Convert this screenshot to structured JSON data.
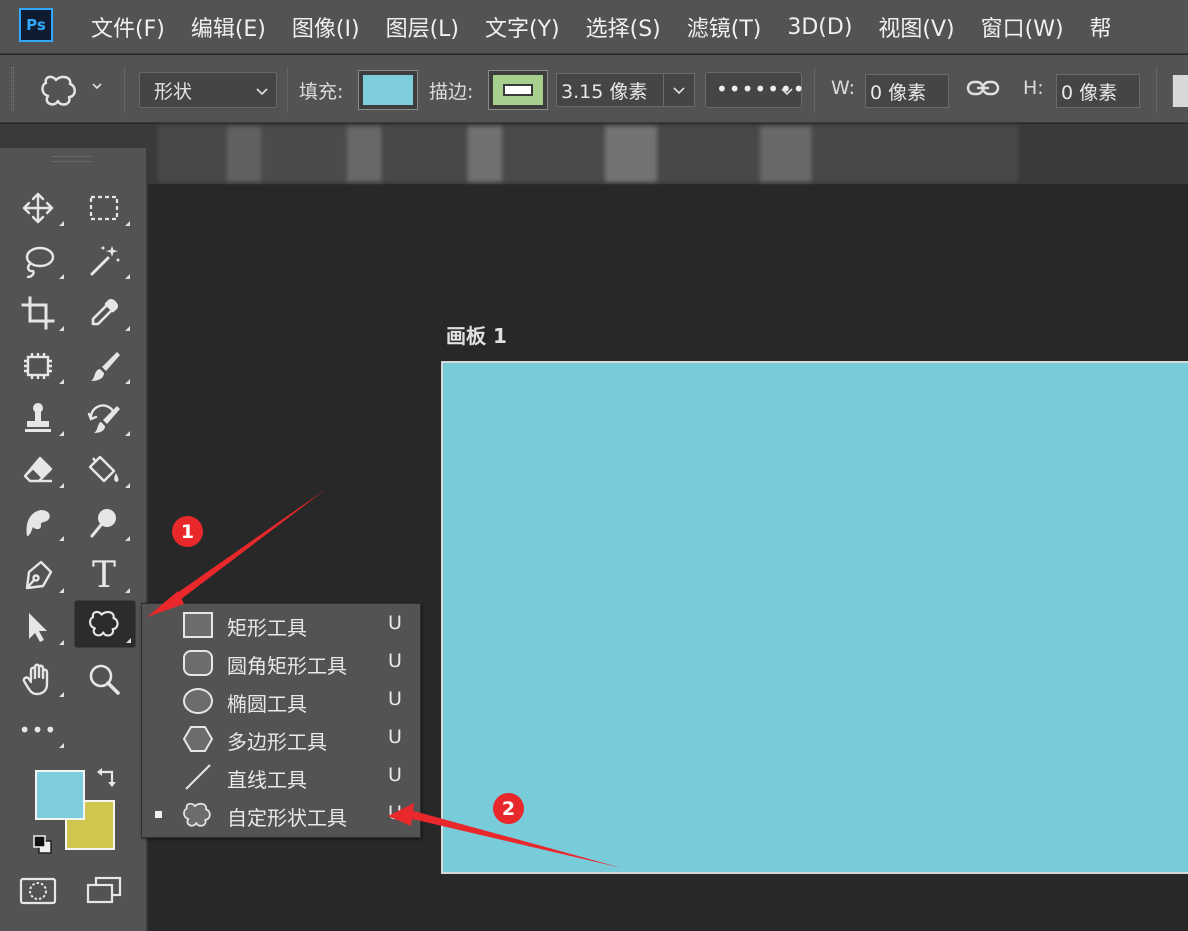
{
  "app": {
    "logo_text": "Ps"
  },
  "menu": [
    "文件(F)",
    "编辑(E)",
    "图像(I)",
    "图层(L)",
    "文字(Y)",
    "选择(S)",
    "滤镜(T)",
    "3D(D)",
    "视图(V)",
    "窗口(W)",
    "帮"
  ],
  "options": {
    "mode_value": "形状",
    "fill_label": "填充:",
    "stroke_label": "描边:",
    "stroke_width": "3.15 像素",
    "w_label": "W:",
    "w_value": "0 像素",
    "h_label": "H:",
    "h_value": "0 像素",
    "dash_glyph": "•••••••",
    "fill_color": "#7ecddd",
    "stroke_color": "#a7cf8e"
  },
  "panel": {
    "collapse_glyph": "<<"
  },
  "toolbar": {
    "foreground_color": "#7ecddd",
    "background_color": "#cfc650",
    "type_glyph": "T",
    "more_glyph": "•••"
  },
  "canvas": {
    "artboard_label": "画板 1",
    "artboard_color": "#78ccda"
  },
  "flyout": {
    "items": [
      {
        "label": "矩形工具",
        "key": "U",
        "icon": "rectangle-icon"
      },
      {
        "label": "圆角矩形工具",
        "key": "U",
        "icon": "rounded-rectangle-icon"
      },
      {
        "label": "椭圆工具",
        "key": "U",
        "icon": "ellipse-icon"
      },
      {
        "label": "多边形工具",
        "key": "U",
        "icon": "polygon-icon"
      },
      {
        "label": "直线工具",
        "key": "U",
        "icon": "line-icon"
      },
      {
        "label": "自定形状工具",
        "key": "U",
        "icon": "custom-shape-icon",
        "selected": true
      }
    ]
  },
  "annotations": {
    "badge_1": "1",
    "badge_2": "2",
    "arrow_color": "#e8282b"
  }
}
